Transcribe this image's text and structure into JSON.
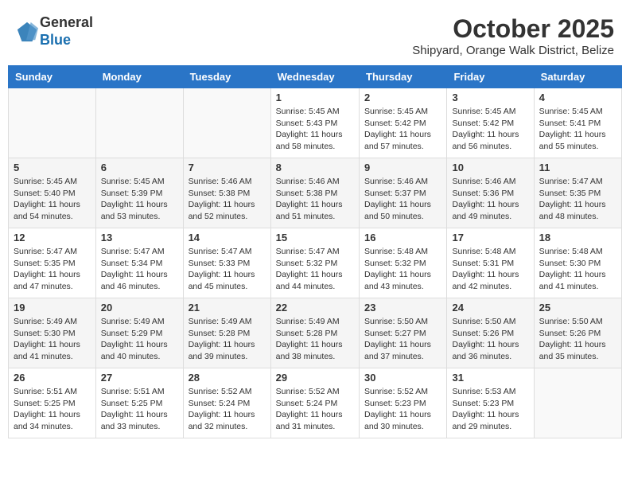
{
  "header": {
    "logo_general": "General",
    "logo_blue": "Blue",
    "month_title": "October 2025",
    "subtitle": "Shipyard, Orange Walk District, Belize"
  },
  "weekdays": [
    "Sunday",
    "Monday",
    "Tuesday",
    "Wednesday",
    "Thursday",
    "Friday",
    "Saturday"
  ],
  "weeks": [
    [
      {
        "day": "",
        "sunrise": "",
        "sunset": "",
        "daylight": ""
      },
      {
        "day": "",
        "sunrise": "",
        "sunset": "",
        "daylight": ""
      },
      {
        "day": "",
        "sunrise": "",
        "sunset": "",
        "daylight": ""
      },
      {
        "day": "1",
        "sunrise": "Sunrise: 5:45 AM",
        "sunset": "Sunset: 5:43 PM",
        "daylight": "Daylight: 11 hours and 58 minutes."
      },
      {
        "day": "2",
        "sunrise": "Sunrise: 5:45 AM",
        "sunset": "Sunset: 5:42 PM",
        "daylight": "Daylight: 11 hours and 57 minutes."
      },
      {
        "day": "3",
        "sunrise": "Sunrise: 5:45 AM",
        "sunset": "Sunset: 5:42 PM",
        "daylight": "Daylight: 11 hours and 56 minutes."
      },
      {
        "day": "4",
        "sunrise": "Sunrise: 5:45 AM",
        "sunset": "Sunset: 5:41 PM",
        "daylight": "Daylight: 11 hours and 55 minutes."
      }
    ],
    [
      {
        "day": "5",
        "sunrise": "Sunrise: 5:45 AM",
        "sunset": "Sunset: 5:40 PM",
        "daylight": "Daylight: 11 hours and 54 minutes."
      },
      {
        "day": "6",
        "sunrise": "Sunrise: 5:45 AM",
        "sunset": "Sunset: 5:39 PM",
        "daylight": "Daylight: 11 hours and 53 minutes."
      },
      {
        "day": "7",
        "sunrise": "Sunrise: 5:46 AM",
        "sunset": "Sunset: 5:38 PM",
        "daylight": "Daylight: 11 hours and 52 minutes."
      },
      {
        "day": "8",
        "sunrise": "Sunrise: 5:46 AM",
        "sunset": "Sunset: 5:38 PM",
        "daylight": "Daylight: 11 hours and 51 minutes."
      },
      {
        "day": "9",
        "sunrise": "Sunrise: 5:46 AM",
        "sunset": "Sunset: 5:37 PM",
        "daylight": "Daylight: 11 hours and 50 minutes."
      },
      {
        "day": "10",
        "sunrise": "Sunrise: 5:46 AM",
        "sunset": "Sunset: 5:36 PM",
        "daylight": "Daylight: 11 hours and 49 minutes."
      },
      {
        "day": "11",
        "sunrise": "Sunrise: 5:47 AM",
        "sunset": "Sunset: 5:35 PM",
        "daylight": "Daylight: 11 hours and 48 minutes."
      }
    ],
    [
      {
        "day": "12",
        "sunrise": "Sunrise: 5:47 AM",
        "sunset": "Sunset: 5:35 PM",
        "daylight": "Daylight: 11 hours and 47 minutes."
      },
      {
        "day": "13",
        "sunrise": "Sunrise: 5:47 AM",
        "sunset": "Sunset: 5:34 PM",
        "daylight": "Daylight: 11 hours and 46 minutes."
      },
      {
        "day": "14",
        "sunrise": "Sunrise: 5:47 AM",
        "sunset": "Sunset: 5:33 PM",
        "daylight": "Daylight: 11 hours and 45 minutes."
      },
      {
        "day": "15",
        "sunrise": "Sunrise: 5:47 AM",
        "sunset": "Sunset: 5:32 PM",
        "daylight": "Daylight: 11 hours and 44 minutes."
      },
      {
        "day": "16",
        "sunrise": "Sunrise: 5:48 AM",
        "sunset": "Sunset: 5:32 PM",
        "daylight": "Daylight: 11 hours and 43 minutes."
      },
      {
        "day": "17",
        "sunrise": "Sunrise: 5:48 AM",
        "sunset": "Sunset: 5:31 PM",
        "daylight": "Daylight: 11 hours and 42 minutes."
      },
      {
        "day": "18",
        "sunrise": "Sunrise: 5:48 AM",
        "sunset": "Sunset: 5:30 PM",
        "daylight": "Daylight: 11 hours and 41 minutes."
      }
    ],
    [
      {
        "day": "19",
        "sunrise": "Sunrise: 5:49 AM",
        "sunset": "Sunset: 5:30 PM",
        "daylight": "Daylight: 11 hours and 41 minutes."
      },
      {
        "day": "20",
        "sunrise": "Sunrise: 5:49 AM",
        "sunset": "Sunset: 5:29 PM",
        "daylight": "Daylight: 11 hours and 40 minutes."
      },
      {
        "day": "21",
        "sunrise": "Sunrise: 5:49 AM",
        "sunset": "Sunset: 5:28 PM",
        "daylight": "Daylight: 11 hours and 39 minutes."
      },
      {
        "day": "22",
        "sunrise": "Sunrise: 5:49 AM",
        "sunset": "Sunset: 5:28 PM",
        "daylight": "Daylight: 11 hours and 38 minutes."
      },
      {
        "day": "23",
        "sunrise": "Sunrise: 5:50 AM",
        "sunset": "Sunset: 5:27 PM",
        "daylight": "Daylight: 11 hours and 37 minutes."
      },
      {
        "day": "24",
        "sunrise": "Sunrise: 5:50 AM",
        "sunset": "Sunset: 5:26 PM",
        "daylight": "Daylight: 11 hours and 36 minutes."
      },
      {
        "day": "25",
        "sunrise": "Sunrise: 5:50 AM",
        "sunset": "Sunset: 5:26 PM",
        "daylight": "Daylight: 11 hours and 35 minutes."
      }
    ],
    [
      {
        "day": "26",
        "sunrise": "Sunrise: 5:51 AM",
        "sunset": "Sunset: 5:25 PM",
        "daylight": "Daylight: 11 hours and 34 minutes."
      },
      {
        "day": "27",
        "sunrise": "Sunrise: 5:51 AM",
        "sunset": "Sunset: 5:25 PM",
        "daylight": "Daylight: 11 hours and 33 minutes."
      },
      {
        "day": "28",
        "sunrise": "Sunrise: 5:52 AM",
        "sunset": "Sunset: 5:24 PM",
        "daylight": "Daylight: 11 hours and 32 minutes."
      },
      {
        "day": "29",
        "sunrise": "Sunrise: 5:52 AM",
        "sunset": "Sunset: 5:24 PM",
        "daylight": "Daylight: 11 hours and 31 minutes."
      },
      {
        "day": "30",
        "sunrise": "Sunrise: 5:52 AM",
        "sunset": "Sunset: 5:23 PM",
        "daylight": "Daylight: 11 hours and 30 minutes."
      },
      {
        "day": "31",
        "sunrise": "Sunrise: 5:53 AM",
        "sunset": "Sunset: 5:23 PM",
        "daylight": "Daylight: 11 hours and 29 minutes."
      },
      {
        "day": "",
        "sunrise": "",
        "sunset": "",
        "daylight": ""
      }
    ]
  ]
}
